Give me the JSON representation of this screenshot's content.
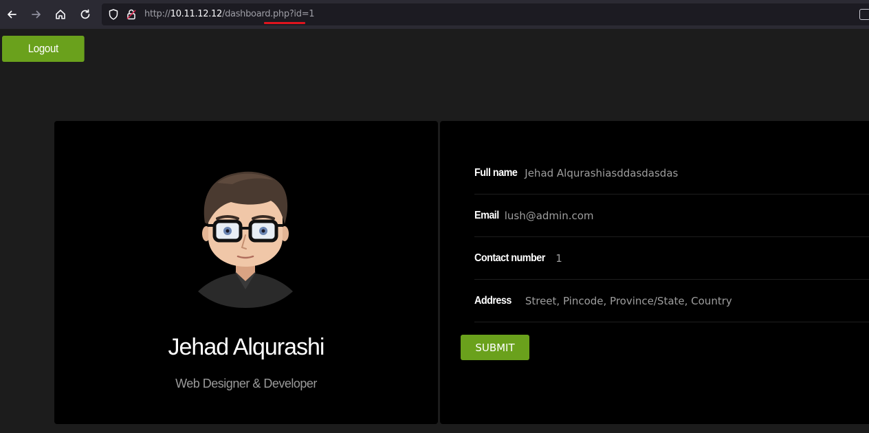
{
  "browser": {
    "url_prefix": "http://",
    "url_host": "10.11.12.12",
    "url_path": "/dashboard.php?id=1",
    "icons": [
      "back-icon",
      "forward-icon",
      "home-icon",
      "reload-icon",
      "shield-icon",
      "insecure-lock-icon"
    ]
  },
  "header": {
    "logout_label": "Logout"
  },
  "profile": {
    "name": "Jehad Alqurashi",
    "role": "Web Designer & Developer"
  },
  "form": {
    "fields": [
      {
        "label": "Full name",
        "value": "Jehad Alqurashiasddasdasdas"
      },
      {
        "label": "Email",
        "value": "lush@admin.com"
      },
      {
        "label": "Contact number",
        "value": "1"
      },
      {
        "label": "Address",
        "value": "Street, Pincode, Province/State, Country"
      }
    ],
    "submit_label": "SUBMIT"
  },
  "colors": {
    "accent": "#6aa11c",
    "page_bg": "#1c1c1c",
    "card_bg": "#000000",
    "url_highlight": "#e0141e"
  }
}
